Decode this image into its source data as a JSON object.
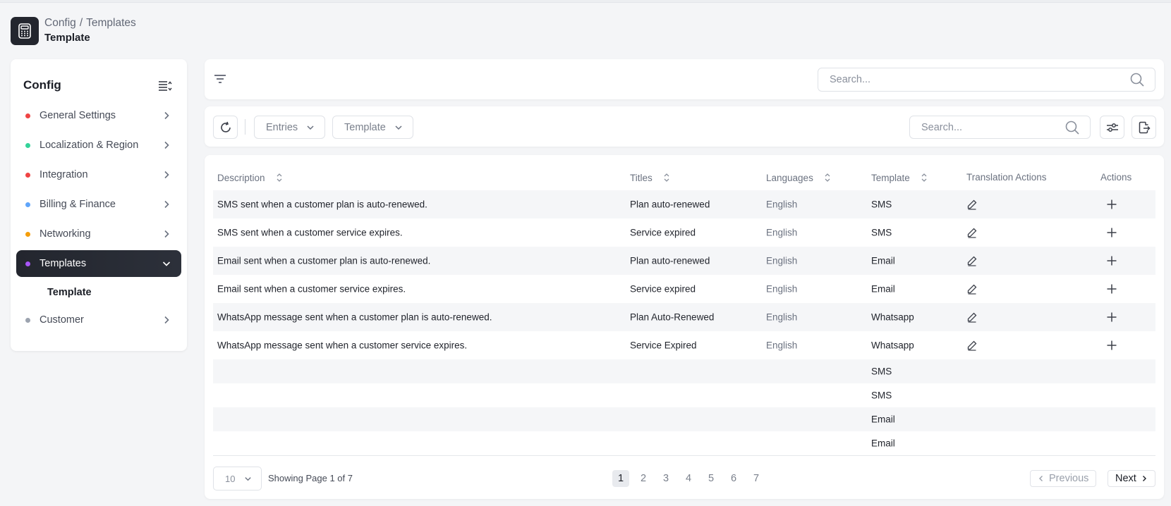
{
  "header": {
    "breadcrumb": [
      "Config",
      "Templates"
    ],
    "breadcrumb_separator": "/",
    "title": "Template",
    "logo_icon": "calculator-icon"
  },
  "sidebar": {
    "title": "Config",
    "collapse_icon": "collapse-list-icon",
    "items": [
      {
        "label": "General Settings",
        "dot_color": "#ef4444"
      },
      {
        "label": "Localization & Region",
        "dot_color": "#34d399"
      },
      {
        "label": "Integration",
        "dot_color": "#ef4444"
      },
      {
        "label": "Billing & Finance",
        "dot_color": "#60a5fa"
      },
      {
        "label": "Networking",
        "dot_color": "#f59e0b"
      },
      {
        "label": "Templates",
        "dot_color": "#a855f7",
        "active": true,
        "expanded": true
      },
      {
        "label": "Customer",
        "dot_color": "#9ca3af"
      }
    ],
    "sub_item": "Template"
  },
  "filter_bar": {
    "search_placeholder": "Search..."
  },
  "toolbar": {
    "entries_label": "Entries",
    "template_label": "Template",
    "search_placeholder": "Search..."
  },
  "table": {
    "columns": [
      "Description",
      "Titles",
      "Languages",
      "Template",
      "Translation Actions",
      "Actions"
    ],
    "rows": [
      {
        "description": "SMS sent when a customer plan is auto-renewed.",
        "title": "Plan auto-renewed",
        "language": "English",
        "template": "SMS"
      },
      {
        "description": "SMS sent when a customer service expires.",
        "title": "Service expired",
        "language": "English",
        "template": "SMS"
      },
      {
        "description": "Email sent when a customer plan is auto-renewed.",
        "title": "Plan auto-renewed",
        "language": "English",
        "template": "Email"
      },
      {
        "description": "Email sent when a customer service expires.",
        "title": "Service expired",
        "language": "English",
        "template": "Email"
      },
      {
        "description": "WhatsApp message sent when a customer plan is auto-renewed.",
        "title": "Plan Auto-Renewed",
        "language": "English",
        "template": "Whatsapp"
      },
      {
        "description": "WhatsApp message sent when a customer service expires.",
        "title": "Service Expired",
        "language": "English",
        "template": "Whatsapp"
      }
    ],
    "extra_rows": [
      {
        "template": "SMS"
      },
      {
        "template": "SMS"
      },
      {
        "template": "Email"
      },
      {
        "template": "Email"
      }
    ]
  },
  "pagination": {
    "page_size": "10",
    "showing_text": "Showing Page 1 of 7",
    "pages": [
      "1",
      "2",
      "3",
      "4",
      "5",
      "6",
      "7"
    ],
    "current_page": "1",
    "previous_label": "Previous",
    "next_label": "Next"
  }
}
